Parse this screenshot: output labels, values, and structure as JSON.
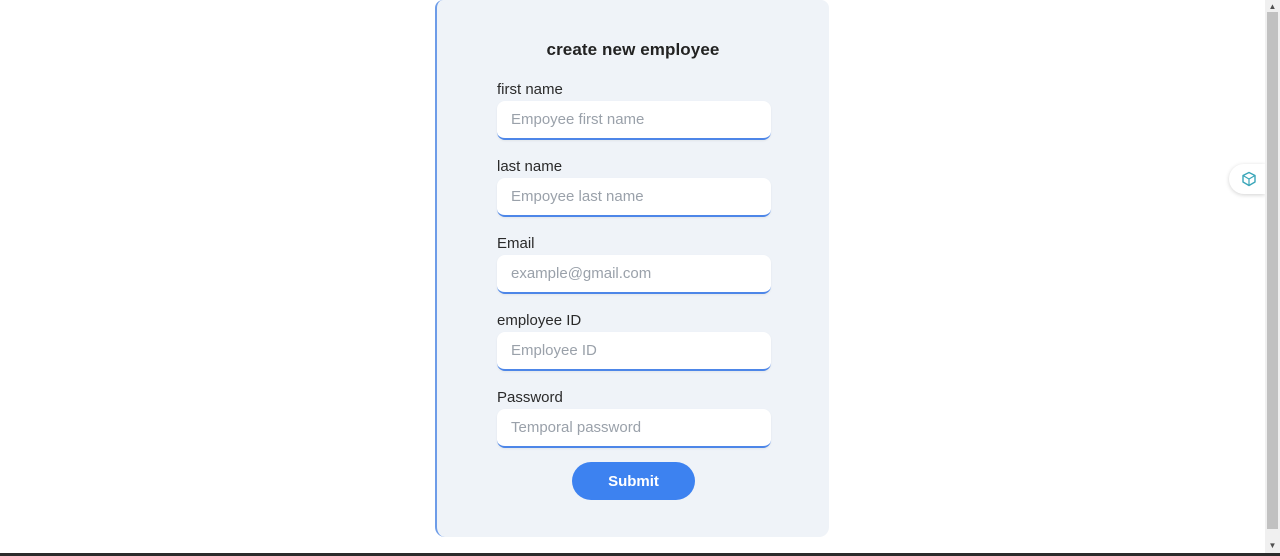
{
  "form": {
    "title": "create new employee",
    "fields": [
      {
        "label": "first name",
        "placeholder": "Empoyee first name",
        "value": ""
      },
      {
        "label": "last name",
        "placeholder": "Empoyee last name",
        "value": ""
      },
      {
        "label": "Email",
        "placeholder": "example@gmail.com",
        "value": ""
      },
      {
        "label": "employee ID",
        "placeholder": "Employee ID",
        "value": ""
      },
      {
        "label": "Password",
        "placeholder": "Temporal password",
        "value": ""
      }
    ],
    "submit_label": "Submit"
  },
  "colors": {
    "accent": "#3d82f0",
    "card_background": "#eff3f8",
    "input_underline": "#4d86e8"
  },
  "extension": {
    "icon": "cube-outline-icon"
  },
  "scrollbar": {
    "up_icon": "scroll-up-arrow-icon",
    "down_icon": "scroll-down-arrow-icon"
  }
}
